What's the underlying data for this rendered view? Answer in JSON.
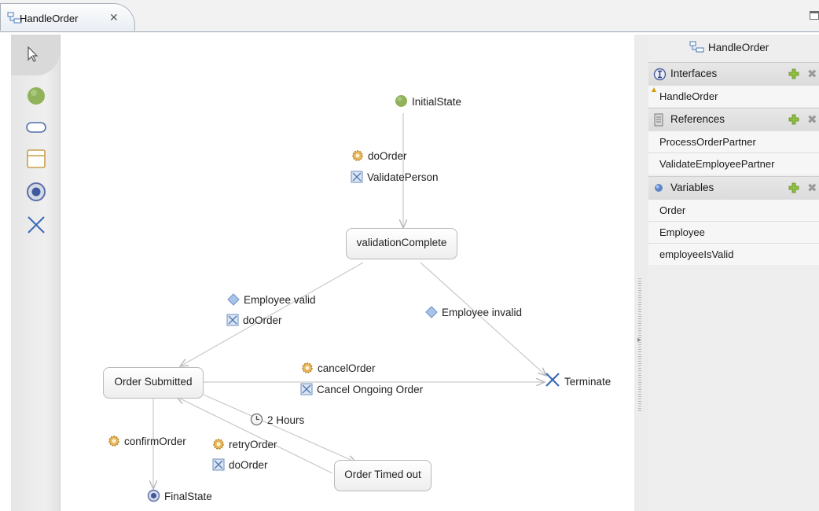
{
  "tab": {
    "title": "HandleOrder",
    "close_glyph": "✕"
  },
  "palette": {
    "tools": [
      "pointer-icon",
      "initial-state-icon",
      "state-icon",
      "transition-icon",
      "final-state-icon",
      "terminate-icon"
    ]
  },
  "canvas": {
    "nodes": {
      "initial_state": "InitialState",
      "validation_complete": "validationComplete",
      "order_submitted": "Order Submitted",
      "order_timed_out": "Order Timed out",
      "terminate": "Terminate",
      "final_state": "FinalState"
    },
    "labels": {
      "do_order_1": "doOrder",
      "validate_person": "ValidatePerson",
      "employee_valid": "Employee valid",
      "do_order_2": "doOrder",
      "employee_invalid": "Employee invalid",
      "cancel_order": "cancelOrder",
      "cancel_ongoing_order": "Cancel Ongoing Order",
      "two_hours": "2 Hours",
      "confirm_order": "confirmOrder",
      "retry_order": "retryOrder",
      "do_order_3": "doOrder"
    },
    "colors": {
      "initial": "#8fb25a",
      "final": "#5d6ea8",
      "terminate": "#3a68b8",
      "edge": "#c9c9c9",
      "decision": "#7ea3d6"
    }
  },
  "properties": {
    "title": "HandleOrder",
    "interfaces": {
      "header": "Interfaces",
      "items": [
        "HandleOrder"
      ]
    },
    "references": {
      "header": "References",
      "items": [
        "ProcessOrderPartner",
        "ValidateEmployeePartner"
      ]
    },
    "variables": {
      "header": "Variables",
      "items": [
        "Order",
        "Employee",
        "employeeIsValid"
      ]
    }
  }
}
